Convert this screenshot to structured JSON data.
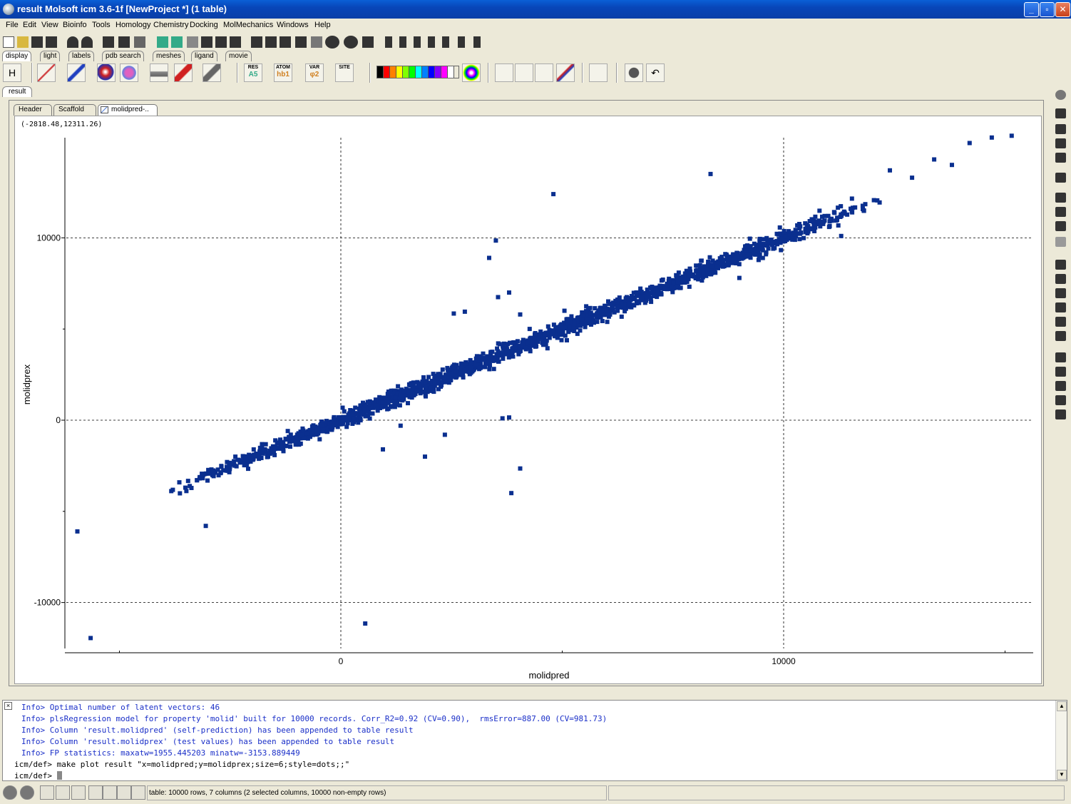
{
  "window": {
    "title": "result Molsoft icm 3.6-1f  [NewProject *] (1 table)"
  },
  "menu": [
    "File",
    "Edit",
    "View",
    "Bioinfo",
    "Tools",
    "Homology",
    "Chemistry",
    "Docking",
    "MolMechanics",
    "Windows",
    "Help"
  ],
  "toolbar_tabs": [
    "display",
    "light",
    "labels",
    "pdb search",
    "meshes",
    "ligand",
    "movie"
  ],
  "toolbar2": {
    "h_label": "H",
    "res_label": "RES",
    "res_sub": "A5",
    "atom_label": "ATOM",
    "atom_sub": "hb1",
    "var_label": "VAR",
    "var_sub": "φ2",
    "site_label": "SITE",
    "palette": [
      "#000000",
      "#ff0000",
      "#ff8000",
      "#ffff00",
      "#80ff00",
      "#00ff00",
      "#00ffff",
      "#0080ff",
      "#0000ff",
      "#8000ff",
      "#ff00ff",
      "#ffffff"
    ]
  },
  "doc_tab": "result",
  "sub_tabs": [
    "Header",
    "Scaffold",
    "molidpred-.."
  ],
  "plot": {
    "coords_readout": "(-2818.48,12311.26)",
    "chart_data": {
      "type": "scatter",
      "xlabel": "molidpred",
      "ylabel": "molidprex",
      "x_ticks": [
        0,
        10000
      ],
      "y_ticks": [
        10000,
        0,
        -10000
      ],
      "xlim": [
        -6200,
        15500
      ],
      "ylim": [
        -12800,
        15500
      ],
      "grid": true,
      "marker_color": "#0a2f8f",
      "trend": {
        "x_start": -4200,
        "x_end": 12400,
        "count": 1800
      },
      "outliers": [
        {
          "x": -5950,
          "y": -6100
        },
        {
          "x": -5650,
          "y": -11950
        },
        {
          "x": -3050,
          "y": -5800
        },
        {
          "x": 550,
          "y": -11150
        },
        {
          "x": 3850,
          "y": -4000
        },
        {
          "x": 4050,
          "y": -2650
        },
        {
          "x": 3650,
          "y": 100
        },
        {
          "x": 3800,
          "y": 150
        },
        {
          "x": 3550,
          "y": 6750
        },
        {
          "x": 3800,
          "y": 7000
        },
        {
          "x": 4050,
          "y": 5800
        },
        {
          "x": 2550,
          "y": 5850
        },
        {
          "x": 2800,
          "y": 5950
        },
        {
          "x": 4800,
          "y": 12400
        },
        {
          "x": 5050,
          "y": 6000
        },
        {
          "x": 3350,
          "y": 8900
        },
        {
          "x": 3500,
          "y": 9850
        },
        {
          "x": 8350,
          "y": 13500
        },
        {
          "x": 9600,
          "y": 9100
        },
        {
          "x": 9000,
          "y": 7800
        },
        {
          "x": 1900,
          "y": -2000
        },
        {
          "x": 2350,
          "y": -800
        },
        {
          "x": 950,
          "y": -1600
        },
        {
          "x": 1350,
          "y": -300
        },
        {
          "x": 12400,
          "y": 13700
        },
        {
          "x": 13400,
          "y": 14300
        },
        {
          "x": 14200,
          "y": 15200
        },
        {
          "x": 15150,
          "y": 15600
        },
        {
          "x": 14700,
          "y": 15500
        },
        {
          "x": 12900,
          "y": 13300
        },
        {
          "x": 13800,
          "y": 14000
        },
        {
          "x": 10800,
          "y": 10900
        },
        {
          "x": 11300,
          "y": 10100
        }
      ]
    }
  },
  "console": {
    "info_lines": [
      "Info> Optimal number of latent vectors: 46",
      "Info> plsRegression model for property 'molid' built for 10000 records. Corr_R2=0.92 (CV=0.90),  rmsError=887.00 (CV=981.73)",
      "Info> Column 'result.molidpred' (self-prediction) has been appended to table result",
      "Info> Column 'result.molidprex' (test values) has been appended to table result",
      "Info> FP statistics: maxatw=1955.445203 minatw=-3153.889449"
    ],
    "command_line": "icm/def> make plot result \"x=molidpred;y=molidprex;size=6;style=dots;;\"",
    "prompt": "icm/def> "
  },
  "status": {
    "text": "table: 10000 rows, 7 columns (2 selected columns, 10000 non-empty rows)"
  }
}
